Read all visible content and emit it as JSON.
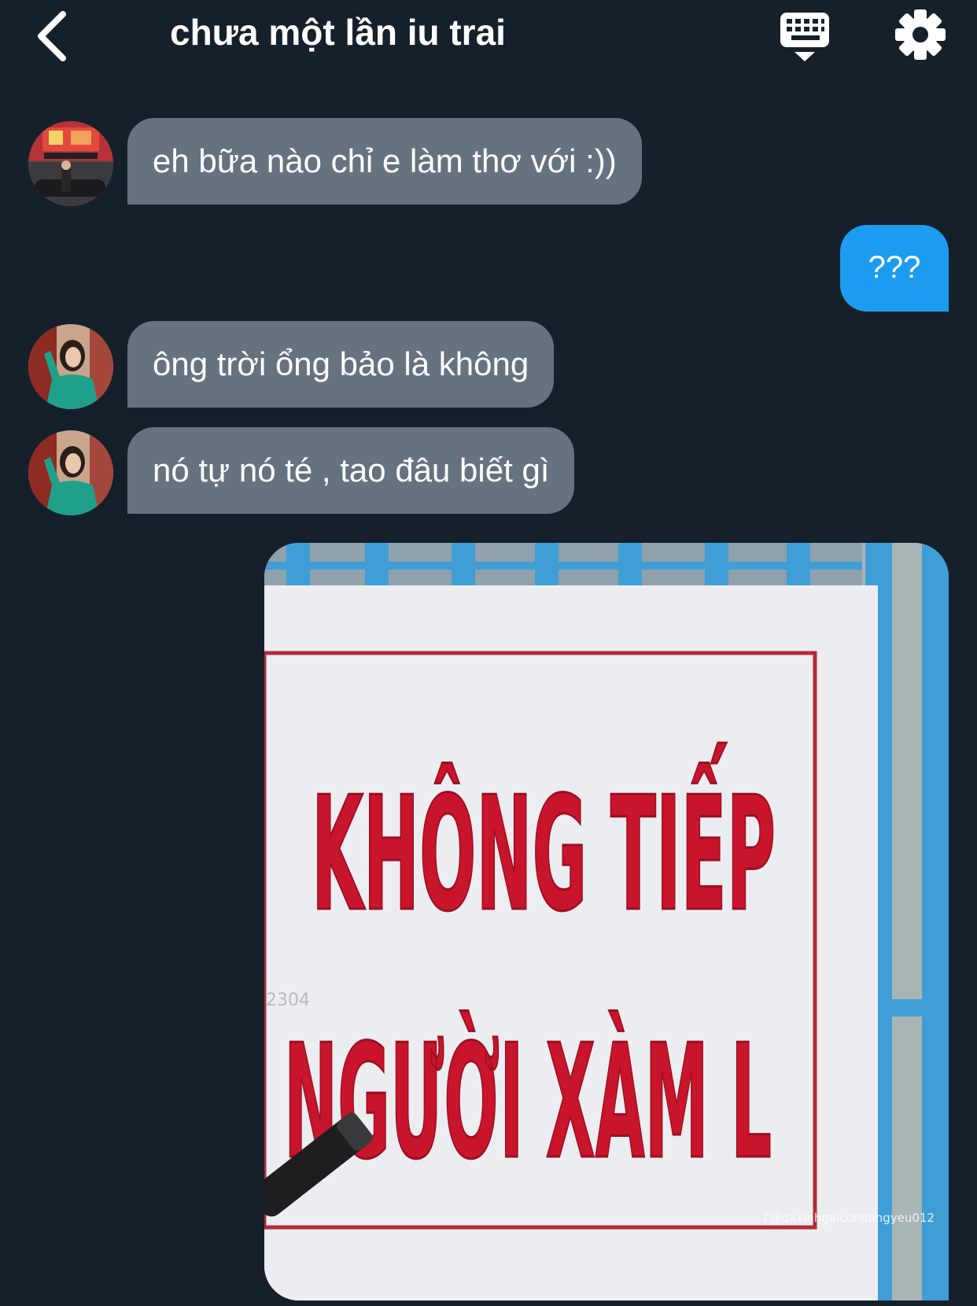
{
  "header": {
    "title": "chưa một lần iu trai",
    "back_icon": "chevron-left-icon",
    "keyboard_icon": "keyboard-icon",
    "settings_icon": "gear-icon"
  },
  "messages": [
    {
      "side": "incoming",
      "text": "eh bữa nào chỉ e làm thơ với :))"
    },
    {
      "side": "outgoing",
      "text": "???"
    },
    {
      "side": "incoming",
      "text": "ông trời ổng bảo là không"
    },
    {
      "side": "incoming",
      "text": "nó tự nó té , tao đâu biết gì"
    }
  ],
  "image_message": {
    "sign_line1": "KHÔNG TIẾP",
    "sign_line2": "NGƯỜI XÀM L",
    "faint_number": "2304",
    "watermark": "♪@daxinhgaicondangyeu012"
  },
  "colors": {
    "background": "#15202b",
    "incoming_bubble": "#66727f",
    "outgoing_bubble": "#1d9bf0",
    "sign_text": "#c8152b"
  }
}
